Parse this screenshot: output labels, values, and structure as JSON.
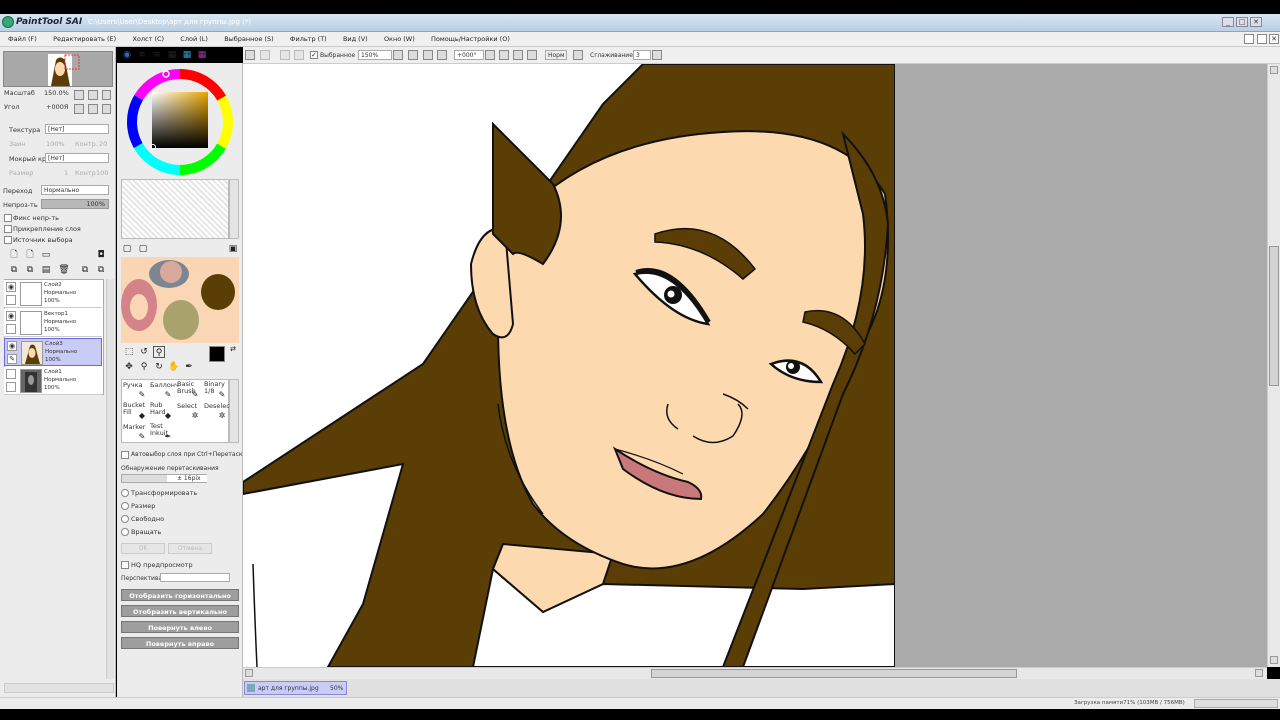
{
  "title": {
    "app_logo": "PaintTool SAI",
    "file": "C:\\Users\\User\\Desktop\\арт для группы.jpg (*)"
  },
  "menu": [
    "Файл (F)",
    "Редактировать (E)",
    "Холст (C)",
    "Слой (L)",
    "Выбранное (S)",
    "Фильтр (T)",
    "Вид (V)",
    "Окно (W)",
    "Помощь/Настройки (O)"
  ],
  "navigator": {
    "zoom_label": "Масштаб",
    "zoom_value": "150.0%",
    "angle_label": "Угол",
    "angle_value": "+000Я"
  },
  "texture": {
    "label": "Текстура",
    "value": "[Нет]",
    "scale_label": "Заин",
    "scale_value": "100%",
    "strength_label": "Контр.",
    "strength_value": "20"
  },
  "wet_edge": {
    "label": "Мокрый край",
    "value": "[Нет]",
    "size_label": "Размер",
    "size_value": "1",
    "strength_label": "Контр",
    "strength_value": "100"
  },
  "blend": {
    "label": "Переход",
    "value": "Нормально",
    "opacity_label": "Непроз-ть",
    "opacity_value": "100%"
  },
  "checks": {
    "fix_opacity": "Фикс непр-ть",
    "clip_layer": "Прикрепление слоя",
    "selection_source": "Источник выбора"
  },
  "layers": [
    {
      "name": "Слой2",
      "mode": "Нормально",
      "opacity": "100%"
    },
    {
      "name": "Вектор1",
      "mode": "Нормально",
      "opacity": "100%"
    },
    {
      "name": "Слой3",
      "mode": "Нормально",
      "opacity": "100%"
    },
    {
      "name": "Слой1",
      "mode": "Нормально",
      "opacity": "100%"
    }
  ],
  "tools": [
    {
      "name": "Ручка"
    },
    {
      "name": "Баллонч"
    },
    {
      "name": "Basic Brush"
    },
    {
      "name": "Binary 1/8"
    },
    {
      "name": "Bucket Fill"
    },
    {
      "name": "Rub Hard"
    },
    {
      "name": "Select"
    },
    {
      "name": "Deselect"
    },
    {
      "name": "Marker"
    },
    {
      "name": "Test Inkuit"
    }
  ],
  "transform": {
    "auto_select": "Автовыбор слоя при Ctrl+Перетаскив",
    "drag_detect": "Обнаружение перетаскивания",
    "drag_value": "± 16pix",
    "options": [
      "Трансформировать",
      "Размер",
      "Свободно",
      "Вращать"
    ],
    "ok": "OK",
    "cancel": "Отмена",
    "hq_preview": "HQ предпросмотр",
    "perspective": "Перспектива",
    "flip_h": "Отобразить горизонтально",
    "flip_v": "Отобразить вертикально",
    "rot_left": "Повернуть влево",
    "rot_right": "Повернуть вправо"
  },
  "toolbar": {
    "selection": "Выбранное",
    "zoom": "150%",
    "angle": "+000°",
    "mode": "Норм",
    "stab_label": "Сглаживание",
    "stab_value": "3"
  },
  "tab": {
    "name": "арт для группы.jpg",
    "zoom": "50%"
  },
  "status": "Загрузка памяти71% (103MB / 756MB)",
  "colors": {
    "hair": "#5a3e05",
    "skin": "#fdd9b0",
    "lips": "#c8787a",
    "fg": "#000000"
  }
}
